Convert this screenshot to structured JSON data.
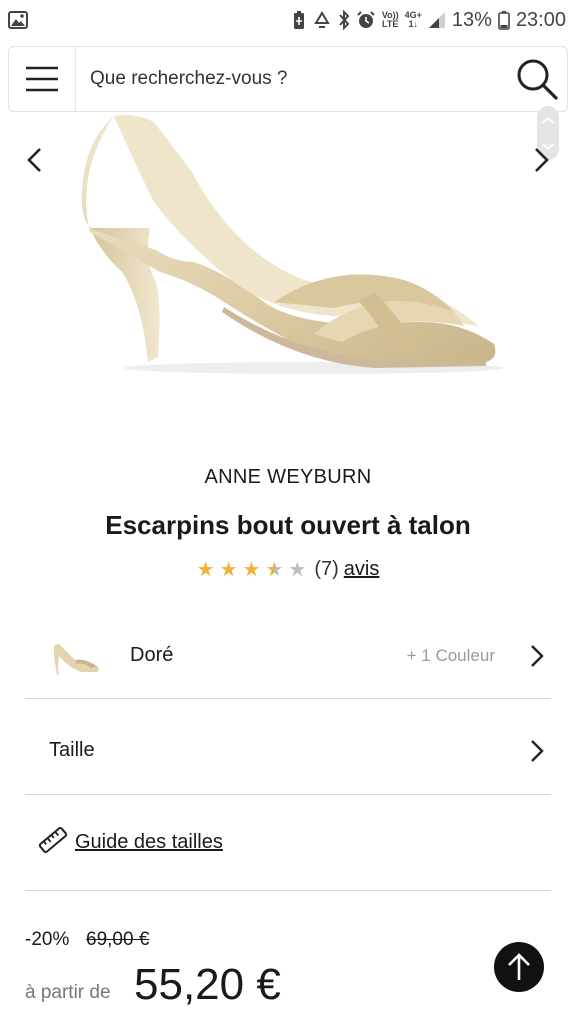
{
  "statusbar": {
    "volte_top": "Vo))",
    "volte_bottom": "LTE",
    "net_top": "4G+",
    "net_bottom": "1↓",
    "battery": "13%",
    "time": "23:00"
  },
  "search": {
    "placeholder": "Que recherchez-vous ?"
  },
  "product": {
    "brand": "ANNE WEYBURN",
    "title": "Escarpins bout ouvert à talon",
    "rating": {
      "value": 3.5,
      "max": 5,
      "count_text": "(7)",
      "avis_label": "avis"
    }
  },
  "color_row": {
    "name": "Doré",
    "more": "+ 1 Couleur"
  },
  "size_row": {
    "label": "Taille"
  },
  "guide": {
    "label": "Guide des tailles"
  },
  "price": {
    "discount": "-20%",
    "old": "69,00 €",
    "from_label": "à partir de",
    "current": "55,20 €"
  },
  "colors": {
    "star_filled": "#f2b134",
    "star_empty": "#bdbdbd",
    "shoe_gold": "#e9dcc0"
  }
}
